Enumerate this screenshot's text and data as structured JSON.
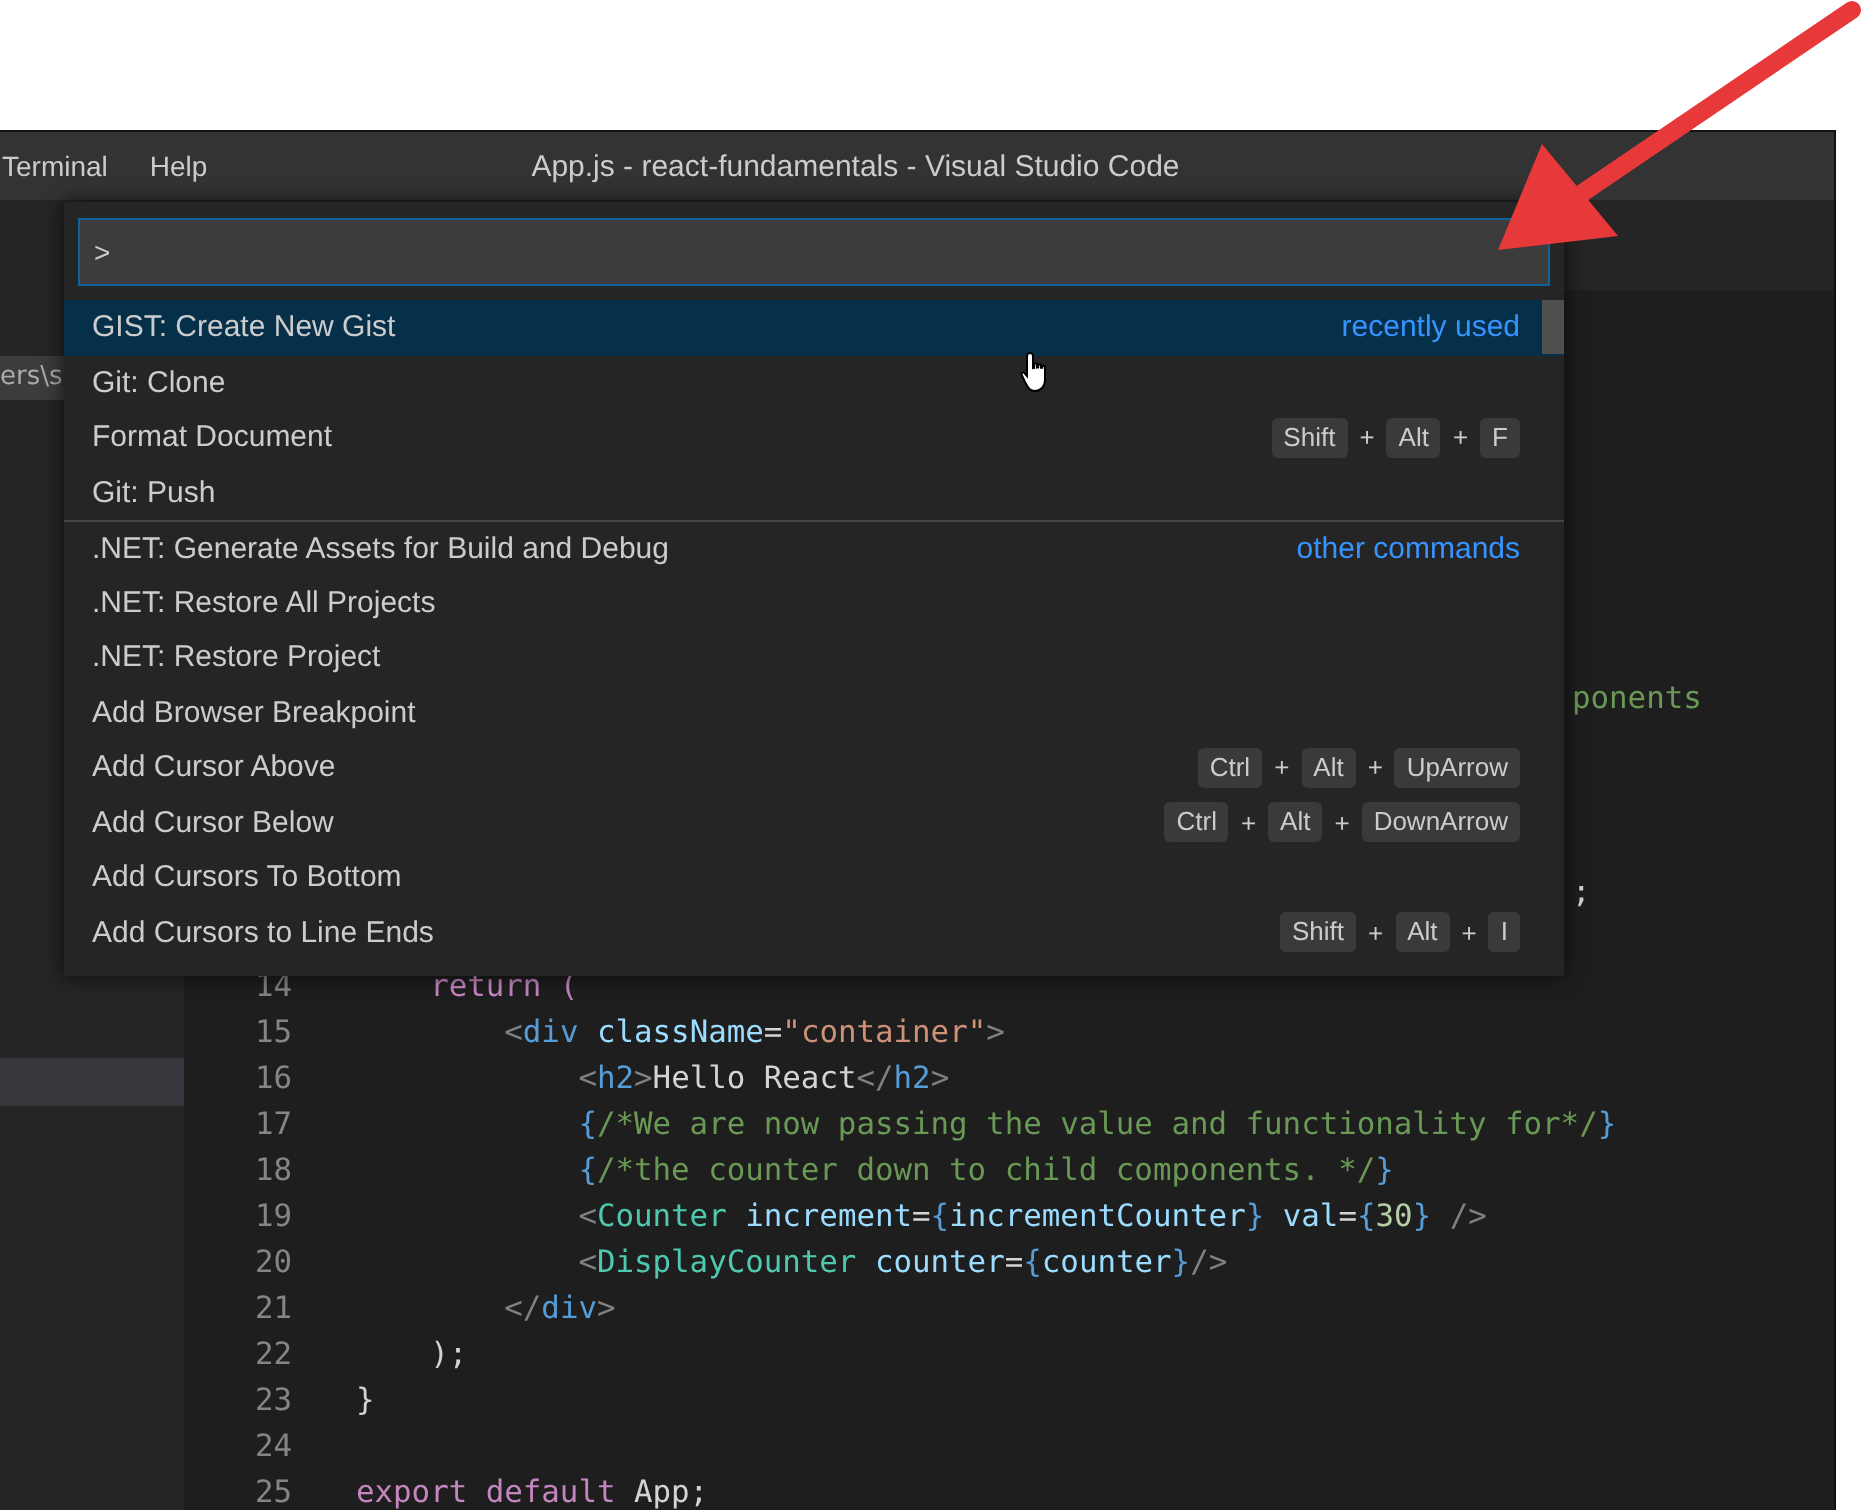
{
  "window": {
    "title": "App.js - react-fundamentals - Visual Studio Code"
  },
  "menu": [
    "Terminal",
    "Help"
  ],
  "sidebar": {
    "path_fragment": "ers\\s"
  },
  "command_palette": {
    "input": {
      "value": ">"
    },
    "items": [
      {
        "label": "GIST: Create New Gist",
        "selected": true,
        "group": "recently used"
      },
      {
        "label": "Git: Clone",
        "selected": false
      },
      {
        "label": "Format Document",
        "selected": false,
        "shortcut": [
          {
            "kind": "key",
            "text": "Shift"
          },
          {
            "kind": "plus",
            "text": "+"
          },
          {
            "kind": "key",
            "text": "Alt"
          },
          {
            "kind": "plus",
            "text": "+"
          },
          {
            "kind": "key",
            "text": "F"
          }
        ]
      },
      {
        "label": "Git: Push",
        "selected": false
      },
      {
        "label": ".NET: Generate Assets for Build and Debug",
        "selected": false,
        "group": "other commands"
      },
      {
        "label": ".NET: Restore All Projects",
        "selected": false
      },
      {
        "label": ".NET: Restore Project",
        "selected": false
      },
      {
        "label": "Add Browser Breakpoint",
        "selected": false
      },
      {
        "label": "Add Cursor Above",
        "selected": false,
        "shortcut": [
          {
            "kind": "key",
            "text": "Ctrl"
          },
          {
            "kind": "plus",
            "text": "+"
          },
          {
            "kind": "key",
            "text": "Alt"
          },
          {
            "kind": "plus",
            "text": "+"
          },
          {
            "kind": "key",
            "text": "UpArrow"
          }
        ]
      },
      {
        "label": "Add Cursor Below",
        "selected": false,
        "shortcut": [
          {
            "kind": "key",
            "text": "Ctrl"
          },
          {
            "kind": "plus",
            "text": "+"
          },
          {
            "kind": "key",
            "text": "Alt"
          },
          {
            "kind": "plus",
            "text": "+"
          },
          {
            "kind": "key",
            "text": "DownArrow"
          }
        ]
      },
      {
        "label": "Add Cursors To Bottom",
        "selected": false
      },
      {
        "label": "Add Cursors to Line Ends",
        "selected": false,
        "shortcut": [
          {
            "kind": "key",
            "text": "Shift"
          },
          {
            "kind": "plus",
            "text": "+"
          },
          {
            "kind": "key",
            "text": "Alt"
          },
          {
            "kind": "plus",
            "text": "+"
          },
          {
            "kind": "key",
            "text": "I"
          }
        ]
      }
    ]
  },
  "editor": {
    "covered_fragments": [
      {
        "text": "ponents",
        "kind": "comment"
      },
      {
        "text": ";",
        "kind": "text"
      }
    ],
    "lines": [
      {
        "number": "14",
        "tokens": [
          {
            "text": "    return (",
            "kind": "keyword"
          }
        ]
      },
      {
        "number": "15",
        "tokens": [
          {
            "text": "        <",
            "kind": "bracket"
          },
          {
            "text": "div",
            "kind": "tag"
          },
          {
            "text": " className",
            "kind": "attr"
          },
          {
            "text": "=",
            "kind": "text"
          },
          {
            "text": "\"container\"",
            "kind": "string"
          },
          {
            "text": ">",
            "kind": "bracket"
          }
        ]
      },
      {
        "number": "16",
        "tokens": [
          {
            "text": "            <",
            "kind": "bracket"
          },
          {
            "text": "h2",
            "kind": "tag"
          },
          {
            "text": ">",
            "kind": "bracket"
          },
          {
            "text": "Hello React",
            "kind": "text"
          },
          {
            "text": "</",
            "kind": "bracket"
          },
          {
            "text": "h2",
            "kind": "tag"
          },
          {
            "text": ">",
            "kind": "bracket"
          }
        ]
      },
      {
        "number": "17",
        "tokens": [
          {
            "text": "            {",
            "kind": "brace"
          },
          {
            "text": "/*We are now passing the value and functionality for*/",
            "kind": "comment"
          },
          {
            "text": "}",
            "kind": "brace"
          }
        ]
      },
      {
        "number": "18",
        "tokens": [
          {
            "text": "            {",
            "kind": "brace"
          },
          {
            "text": "/*the counter down to child components. */",
            "kind": "comment"
          },
          {
            "text": "}",
            "kind": "brace"
          }
        ]
      },
      {
        "number": "19",
        "tokens": [
          {
            "text": "            <",
            "kind": "bracket"
          },
          {
            "text": "Counter",
            "kind": "component"
          },
          {
            "text": " increment",
            "kind": "attr"
          },
          {
            "text": "=",
            "kind": "text"
          },
          {
            "text": "{",
            "kind": "brace"
          },
          {
            "text": "incrementCounter",
            "kind": "attr"
          },
          {
            "text": "}",
            "kind": "brace"
          },
          {
            "text": " val",
            "kind": "attr"
          },
          {
            "text": "=",
            "kind": "text"
          },
          {
            "text": "{",
            "kind": "brace"
          },
          {
            "text": "30",
            "kind": "number"
          },
          {
            "text": "}",
            "kind": "brace"
          },
          {
            "text": " />",
            "kind": "bracket"
          }
        ]
      },
      {
        "number": "20",
        "tokens": [
          {
            "text": "            <",
            "kind": "bracket"
          },
          {
            "text": "DisplayCounter",
            "kind": "component"
          },
          {
            "text": " counter",
            "kind": "attr"
          },
          {
            "text": "=",
            "kind": "text"
          },
          {
            "text": "{",
            "kind": "brace"
          },
          {
            "text": "counter",
            "kind": "attr"
          },
          {
            "text": "}",
            "kind": "brace"
          },
          {
            "text": "/>",
            "kind": "bracket"
          }
        ]
      },
      {
        "number": "21",
        "tokens": [
          {
            "text": "        </",
            "kind": "bracket"
          },
          {
            "text": "div",
            "kind": "tag"
          },
          {
            "text": ">",
            "kind": "bracket"
          }
        ]
      },
      {
        "number": "22",
        "tokens": [
          {
            "text": "    );",
            "kind": "text"
          }
        ]
      },
      {
        "number": "23",
        "tokens": [
          {
            "text": "}",
            "kind": "text"
          }
        ]
      },
      {
        "number": "24"
      },
      {
        "number": "25",
        "tokens": [
          {
            "text": "export default",
            "kind": "keyword"
          },
          {
            "text": " App;",
            "kind": "text"
          }
        ]
      }
    ]
  }
}
